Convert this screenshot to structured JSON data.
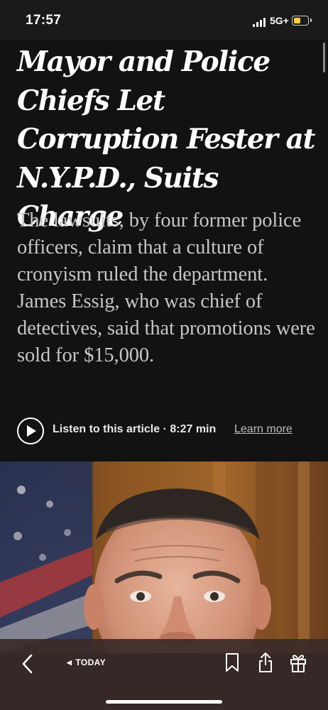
{
  "status_bar": {
    "time": "17:57",
    "network": "5G+",
    "battery_level": 0.5,
    "battery_color": "#f6d23a"
  },
  "article": {
    "headline": "Mayor and Police Chiefs Let Corruption Fester at N.Y.P.D., Suits Charge",
    "summary": "The lawsuits, by four former police officers, claim that a culture of cronyism ruled the department. James Essig, who was chief of detectives, said that promotions were sold for $15,000.",
    "listen_label": "Listen to this article · 8:27 min",
    "learn_more": "Learn more",
    "play_icon": "play-icon"
  },
  "toolbar": {
    "back_icon": "chevron-left-icon",
    "today_label": "TODAY",
    "icons": [
      "bookmark-icon",
      "share-icon",
      "gift-icon"
    ]
  },
  "colors": {
    "background": "#121212",
    "headline": "#ffffff",
    "summary": "#c7c7c7",
    "toolbar": "#3a2a28"
  }
}
